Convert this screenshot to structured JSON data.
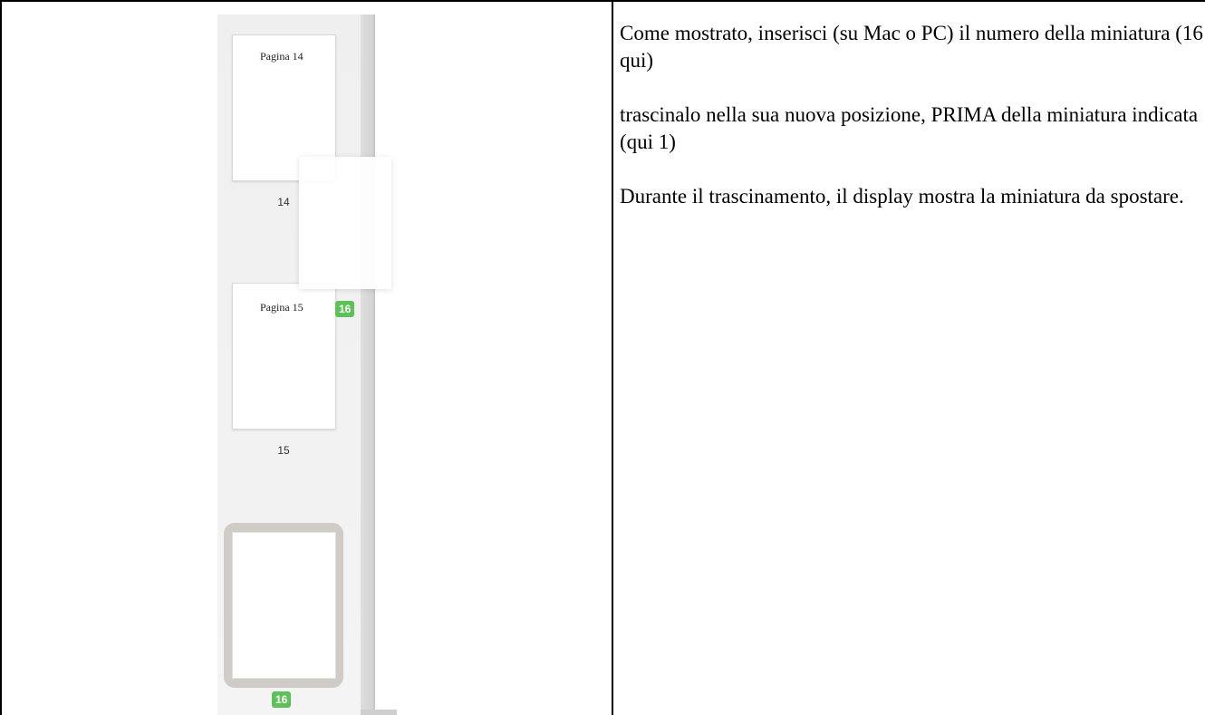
{
  "thumbnails": [
    {
      "caption": "Pagina 14",
      "number": "14"
    },
    {
      "caption": "Pagina 15",
      "number": "15"
    }
  ],
  "dragged_badge": "16",
  "selected_thumbnail": {
    "number": "16"
  },
  "instructions": [
    "Come mostrato, inserisci (su Mac o PC) il numero della miniatura (16 qui)",
    "trascinalo nella sua nuova posizione, PRIMA della miniatura indicata (qui 1)",
    "Durante il trascinamento, il display mostra la miniatura da spostare."
  ],
  "colors": {
    "badge": "#5cc158",
    "selection_frame": "#cfccc8"
  }
}
